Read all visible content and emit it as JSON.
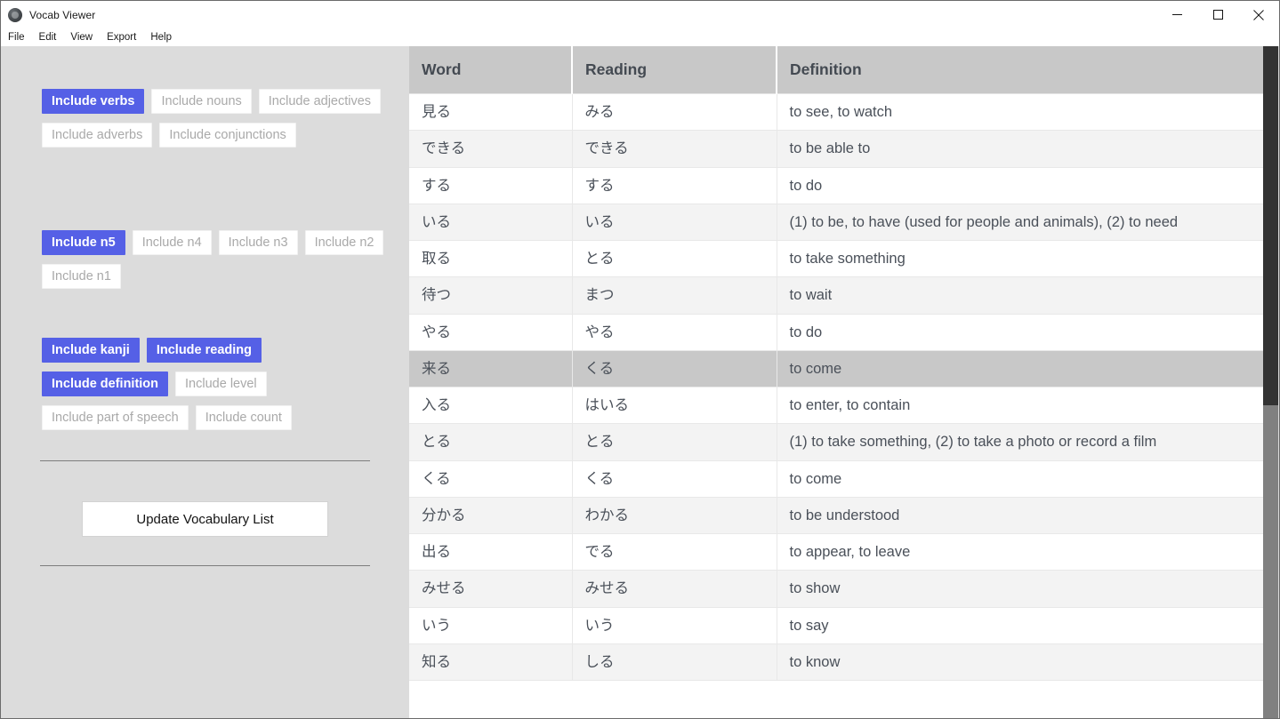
{
  "window": {
    "title": "Vocab Viewer",
    "icon": "app-globe-icon",
    "minimize_label": "—",
    "maximize_label": "□",
    "close_label": "✕"
  },
  "menubar": {
    "items": [
      {
        "label": "File"
      },
      {
        "label": "Edit"
      },
      {
        "label": "View"
      },
      {
        "label": "Export"
      },
      {
        "label": "Help"
      }
    ]
  },
  "filters": {
    "part_of_speech": [
      {
        "label": "Include verbs",
        "active": true
      },
      {
        "label": "Include nouns",
        "active": false
      },
      {
        "label": "Include adjectives",
        "active": false
      },
      {
        "label": "Include adverbs",
        "active": false
      },
      {
        "label": "Include conjunctions",
        "active": false
      }
    ],
    "levels": [
      {
        "label": "Include n5",
        "active": true
      },
      {
        "label": "Include n4",
        "active": false
      },
      {
        "label": "Include n3",
        "active": false
      },
      {
        "label": "Include n2",
        "active": false
      },
      {
        "label": "Include n1",
        "active": false
      }
    ],
    "columns": [
      {
        "label": "Include kanji",
        "active": true
      },
      {
        "label": "Include reading",
        "active": true
      },
      {
        "label": "Include definition",
        "active": true
      },
      {
        "label": "Include level",
        "active": false
      },
      {
        "label": "Include part of speech",
        "active": false
      },
      {
        "label": "Include count",
        "active": false
      }
    ]
  },
  "actions": {
    "update_label": "Update Vocabulary List"
  },
  "colors": {
    "accent": "#5560e6",
    "panel_bg": "#dcdcdc",
    "header_bg": "#c8c8c8",
    "row_alt_bg": "#f3f3f3",
    "row_hover_bg": "#c8c8c8",
    "inactive_text": "#a9a9a9",
    "scroll_thumb": "#333333",
    "scroll_track": "#808080"
  },
  "table": {
    "headers": [
      "Word",
      "Reading",
      "Definition"
    ],
    "highlighted_row_index": 7,
    "rows": [
      {
        "word": "見る",
        "reading": "みる",
        "definition": "to see, to watch"
      },
      {
        "word": "できる",
        "reading": "できる",
        "definition": "to be able to"
      },
      {
        "word": "する",
        "reading": "する",
        "definition": "to do"
      },
      {
        "word": "いる",
        "reading": "いる",
        "definition": "(1) to be, to have (used for people and animals), (2) to need"
      },
      {
        "word": "取る",
        "reading": "とる",
        "definition": "to take something"
      },
      {
        "word": "待つ",
        "reading": "まつ",
        "definition": "to wait"
      },
      {
        "word": "やる",
        "reading": "やる",
        "definition": "to do"
      },
      {
        "word": "来る",
        "reading": "くる",
        "definition": "to come"
      },
      {
        "word": "入る",
        "reading": "はいる",
        "definition": "to enter, to contain"
      },
      {
        "word": "とる",
        "reading": "とる",
        "definition": "(1) to take something, (2) to take a photo or record a film"
      },
      {
        "word": "くる",
        "reading": "くる",
        "definition": "to come"
      },
      {
        "word": "分かる",
        "reading": "わかる",
        "definition": "to be understood"
      },
      {
        "word": "出る",
        "reading": "でる",
        "definition": "to appear, to leave"
      },
      {
        "word": "みせる",
        "reading": "みせる",
        "definition": "to show"
      },
      {
        "word": "いう",
        "reading": "いう",
        "definition": "to say"
      },
      {
        "word": "知る",
        "reading": "しる",
        "definition": "to know"
      }
    ]
  }
}
